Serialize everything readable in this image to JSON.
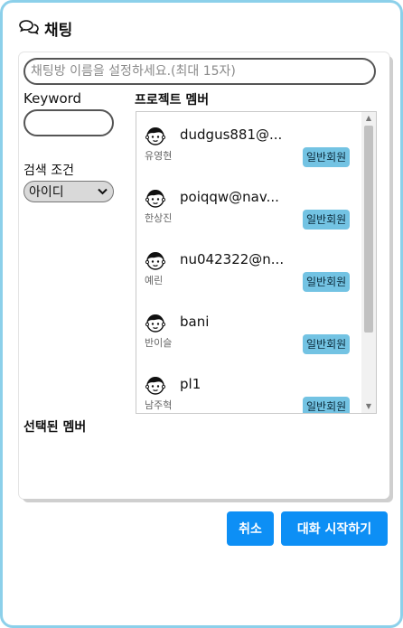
{
  "header": {
    "title": "채팅",
    "icon": "chat-bubbles-icon"
  },
  "room_name": {
    "placeholder": "채팅방 이름을 설정하세요.(최대 15자)",
    "value": ""
  },
  "keyword": {
    "label": "Keyword",
    "value": ""
  },
  "search_condition": {
    "label": "검색 조건",
    "selected": "아이디"
  },
  "project_members": {
    "label": "프로젝트 멤버",
    "members": [
      {
        "email": "dudgus881@...",
        "nickname": "유영현",
        "role": "일반회원"
      },
      {
        "email": "poiqqw@nav...",
        "nickname": "한상진",
        "role": "일반회원"
      },
      {
        "email": "nu042322@n...",
        "nickname": "예린",
        "role": "일반회원"
      },
      {
        "email": "bani",
        "nickname": "반이슬",
        "role": "일반회원"
      },
      {
        "email": "pl1",
        "nickname": "남주혁",
        "role": "일반회원"
      }
    ]
  },
  "selected_members": {
    "label": "선택된 멤버"
  },
  "buttons": {
    "cancel": "취소",
    "start": "대화 시작하기"
  },
  "colors": {
    "accent": "#0d8ff5",
    "frame": "#8cd0ea",
    "badge": "#73c3e3"
  }
}
